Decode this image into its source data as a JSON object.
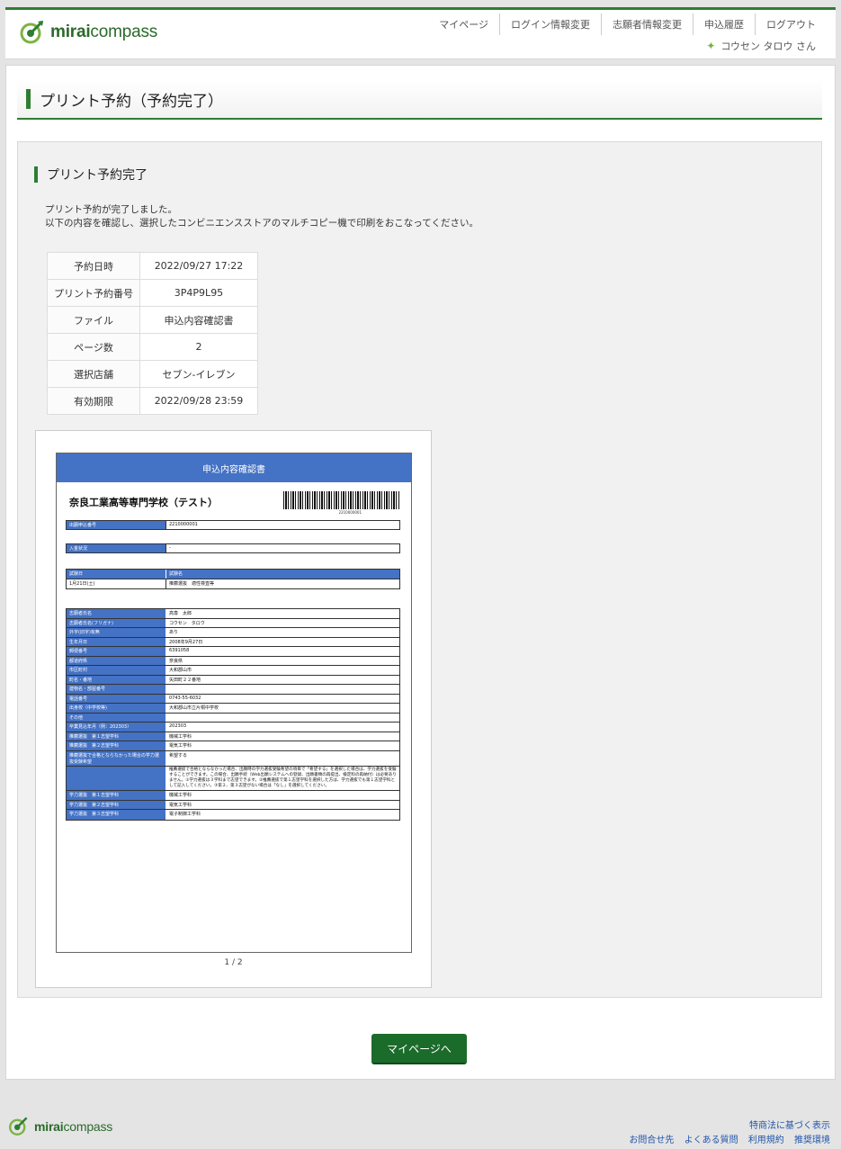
{
  "header": {
    "logo": {
      "brand_bold": "mirai",
      "brand_rest": "compass"
    },
    "nav": [
      "マイページ",
      "ログイン情報変更",
      "志願者情報変更",
      "申込履歴",
      "ログアウト"
    ],
    "user_name": "コウセン タロウ さん"
  },
  "page_title": "プリント予約（予約完了）",
  "section_title": "プリント予約完了",
  "description": {
    "line1": "プリント予約が完了しました。",
    "line2": "以下の内容を確認し、選択したコンビニエンスストアのマルチコピー機で印刷をおこなってください。"
  },
  "info_table": [
    {
      "key": "予約日時",
      "value": "2022/09/27 17:22"
    },
    {
      "key": "プリント予約番号",
      "value": "3P4P9L95"
    },
    {
      "key": "ファイル",
      "value": "申込内容確認書"
    },
    {
      "key": "ページ数",
      "value": "2"
    },
    {
      "key": "選択店舗",
      "value": "セブン-イレブン"
    },
    {
      "key": "有効期限",
      "value": "2022/09/28 23:59"
    }
  ],
  "preview": {
    "doc_title": "申込内容確認書",
    "school": "奈良工業高等専門学校（テスト）",
    "barcode_number": "2210000001",
    "r1": {
      "k": "出願申込番号",
      "v": "2210000001"
    },
    "r2": {
      "k": "入金状況",
      "v": "-"
    },
    "exam_header": {
      "k": "試験日",
      "v": "試験名"
    },
    "exam_row": {
      "k": "1月21日(土)",
      "v": "推薦選抜　適性検査等"
    },
    "rows": [
      {
        "k": "志願者氏名",
        "v": "高専　太郎"
      },
      {
        "k": "志願者氏名(フリガナ)",
        "v": "コウセン　タロウ"
      },
      {
        "k": "外字(旧字)有無",
        "v": "あり"
      },
      {
        "k": "生年月日",
        "v": "2008年9月27日"
      },
      {
        "k": "郵便番号",
        "v": "6391058"
      },
      {
        "k": "都道府県",
        "v": "奈良県"
      },
      {
        "k": "市区町村",
        "v": "大和郡山市"
      },
      {
        "k": "町名・番地",
        "v": "矢田町２２番地"
      },
      {
        "k": "建物名・部屋番号",
        "v": ""
      },
      {
        "k": "電話番号",
        "v": "0743-55-6032"
      },
      {
        "k": "出身校（中学校等)",
        "v": "大和郡山市立片桐中学校"
      },
      {
        "k": "その他",
        "v": ""
      },
      {
        "k": "卒業見込年月（例：202303）",
        "v": "202303"
      },
      {
        "k": "推薦選抜　第１志望学科",
        "v": "機械工学科"
      },
      {
        "k": "推薦選抜　第２志望学科",
        "v": "電気工学科"
      },
      {
        "k": "推薦選抜で合格とならなかった場合の学力選抜受験希望",
        "v": "希望する"
      }
    ],
    "long_note": "推薦選抜で合格とならなかった場合、出願時の学力選抜受験希望の項目で「希望する」を選択した場合は、学力選抜を受験することができます。この場合、出願手続（Web出願システムへの登録、出願書類の再提出、検定料の再納付）は必要ありません。①学力選抜は３学科まで志望できます。②推薦選抜で第１志望学科を選択した方は、学力選抜でも第１志望学科として記入してください。③第２、第３志望がない場合は「なし」を選択してください。",
    "rows2": [
      {
        "k": "学力選抜　第１志望学科",
        "v": "機械工学科"
      },
      {
        "k": "学力選抜　第２志望学科",
        "v": "電気工学科"
      },
      {
        "k": "学力選抜　第３志望学科",
        "v": "電子制御工学科"
      }
    ],
    "pager": "1 / 2"
  },
  "mypage_button": "マイページへ",
  "footer": {
    "links_top": [
      "特商法に基づく表示"
    ],
    "links_bottom": [
      "お問合せ先",
      "よくある質問",
      "利用規約",
      "推奨環境"
    ]
  },
  "colors": {
    "accent": "#2e7d32",
    "button": "#1b6b2a",
    "doc_blue": "#4472c4"
  }
}
